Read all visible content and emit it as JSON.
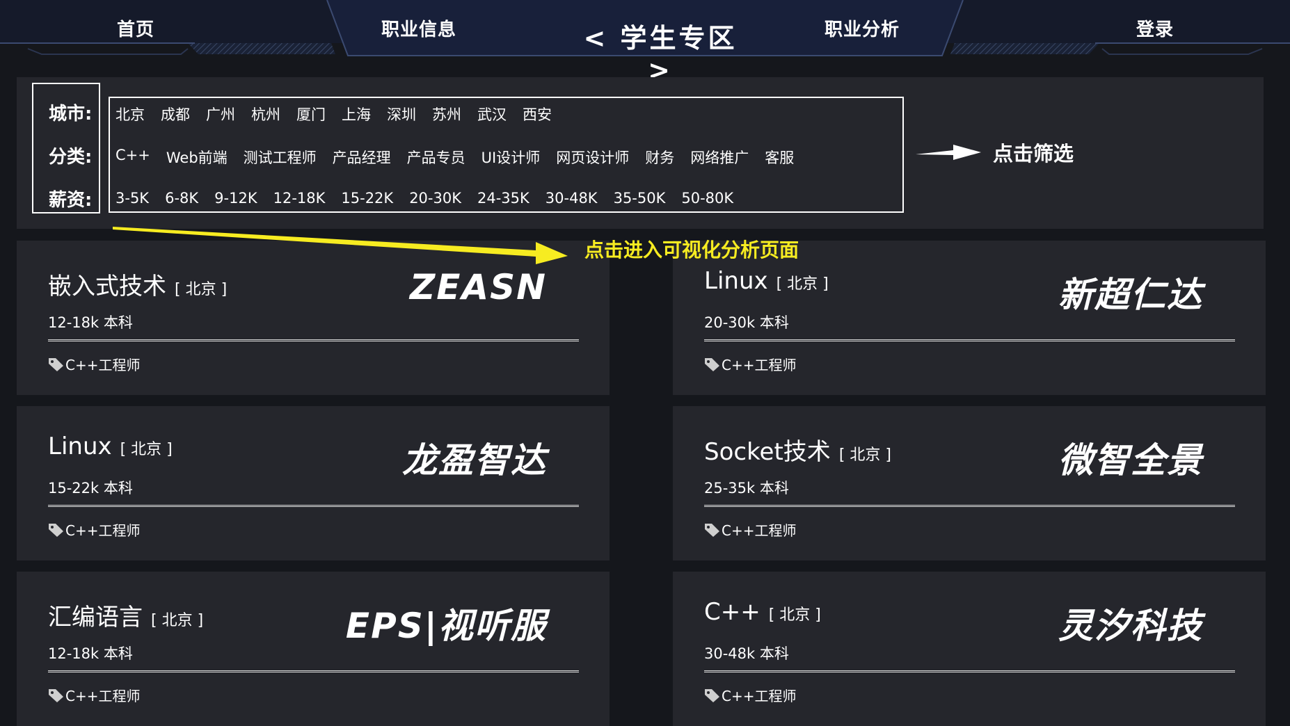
{
  "nav": {
    "home": "首页",
    "job_info": "职业信息",
    "title": "< 学生专区 >",
    "job_analysis": "职业分析",
    "login": "登录"
  },
  "filter": {
    "city_label": "城市:",
    "category_label": "分类:",
    "salary_label": "薪资:",
    "cities": [
      "北京",
      "成都",
      "广州",
      "杭州",
      "厦门",
      "上海",
      "深圳",
      "苏州",
      "武汉",
      "西安"
    ],
    "categories": [
      "C++",
      "Web前端",
      "测试工程师",
      "产品经理",
      "产品专员",
      "UI设计师",
      "网页设计师",
      "财务",
      "网络推广",
      "客服"
    ],
    "salaries": [
      "3-5K",
      "6-8K",
      "9-12K",
      "12-18K",
      "15-22K",
      "20-30K",
      "24-35K",
      "30-48K",
      "35-50K",
      "50-80K"
    ]
  },
  "annotations": {
    "filter_hint": "点击筛选",
    "visual_hint": "点击进入可视化分析页面"
  },
  "jobs": [
    {
      "title": "嵌入式技术",
      "city": "[ 北京 ]",
      "meta": "12-18k  本科",
      "tag": "C++工程师",
      "company": "ZEASN"
    },
    {
      "title": "Linux",
      "city": "[ 北京 ]",
      "meta": "20-30k  本科",
      "tag": "C++工程师",
      "company": "新超仁达"
    },
    {
      "title": "Linux",
      "city": "[ 北京 ]",
      "meta": "15-22k  本科",
      "tag": "C++工程师",
      "company": "龙盈智达"
    },
    {
      "title": "Socket技术",
      "city": "[ 北京 ]",
      "meta": "25-35k  本科",
      "tag": "C++工程师",
      "company": "微智全景"
    },
    {
      "title": "汇编语言",
      "city": "[ 北京 ]",
      "meta": "12-18k  本科",
      "tag": "C++工程师",
      "company": "EPS|视听服"
    },
    {
      "title": "C++",
      "city": "[ 北京 ]",
      "meta": "30-48k  本科",
      "tag": "C++工程师",
      "company": "灵汐科技"
    }
  ],
  "colors": {
    "background": "#15171c",
    "panel": "#25262c",
    "nav": "#151a2a",
    "highlight": "#f7ec21"
  }
}
